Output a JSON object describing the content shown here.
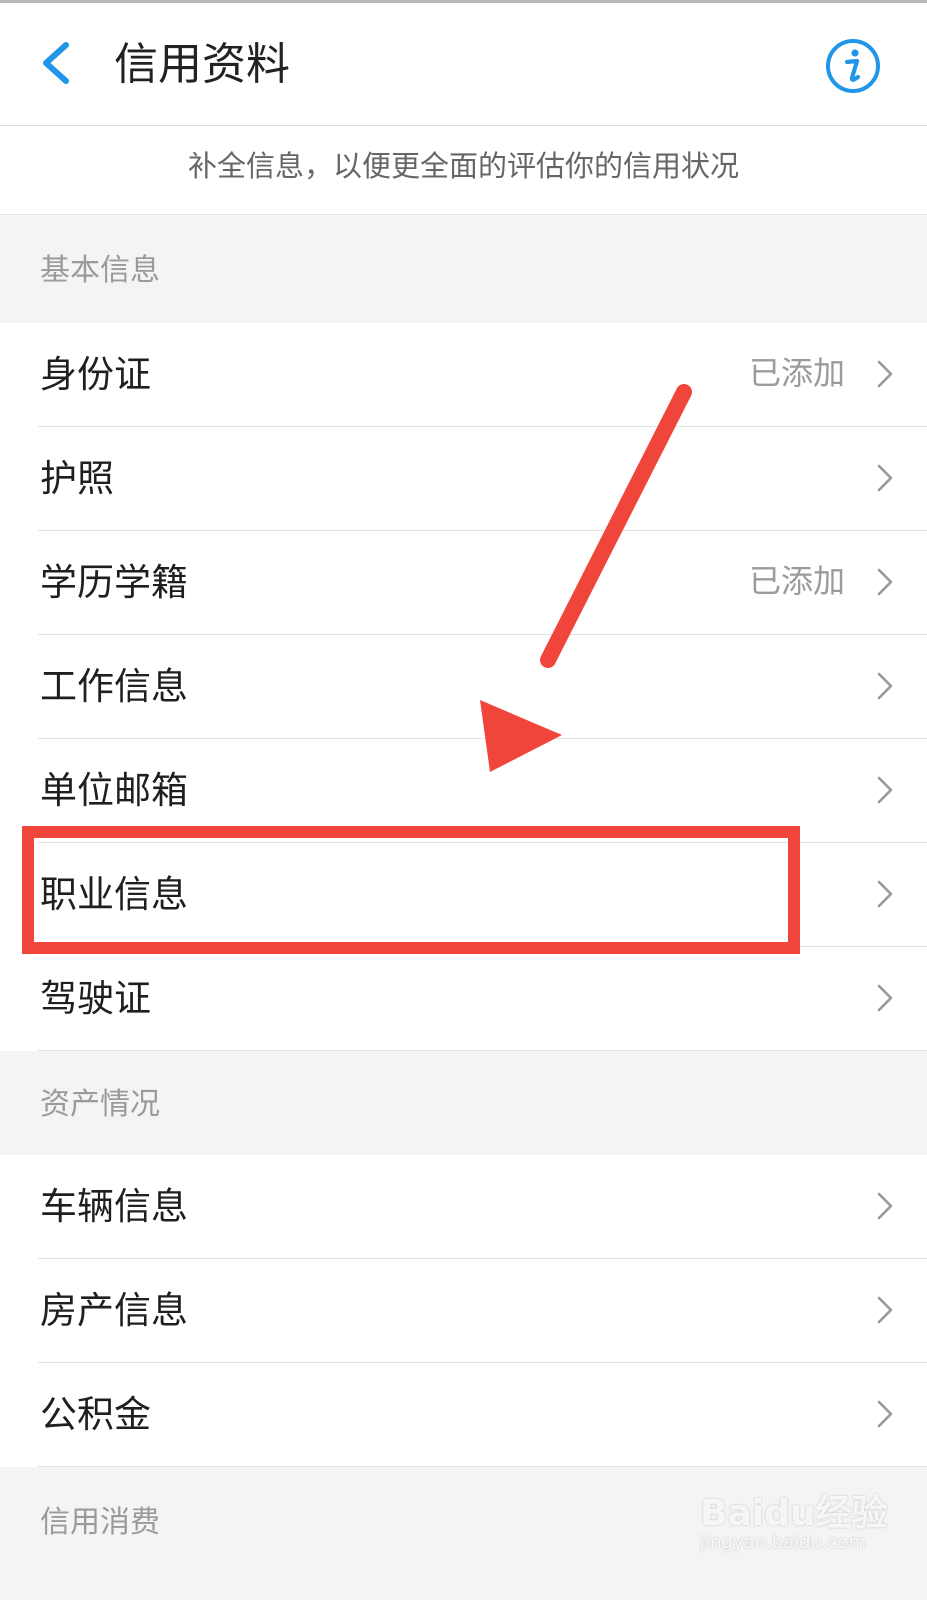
{
  "header": {
    "title": "信用资料",
    "back_icon": "chevron-left-icon",
    "info_icon": "info-circle-icon",
    "accent_color": "#2196e8"
  },
  "subtitle": "补全信息，以便更全面的评估你的信用状况",
  "sections": [
    {
      "title": "基本信息",
      "items": [
        {
          "label": "身份证",
          "status": "已添加"
        },
        {
          "label": "护照",
          "status": ""
        },
        {
          "label": "学历学籍",
          "status": "已添加"
        },
        {
          "label": "工作信息",
          "status": ""
        },
        {
          "label": "单位邮箱",
          "status": ""
        },
        {
          "label": "职业信息",
          "status": ""
        },
        {
          "label": "驾驶证",
          "status": ""
        }
      ]
    },
    {
      "title": "资产情况",
      "items": [
        {
          "label": "车辆信息",
          "status": ""
        },
        {
          "label": "房产信息",
          "status": ""
        },
        {
          "label": "公积金",
          "status": ""
        }
      ]
    },
    {
      "title": "信用消费",
      "items": []
    }
  ],
  "annotation": {
    "highlight_color": "#f0453a",
    "highlighted_item": "职业信息"
  },
  "watermark": {
    "logo": "Baidu经验",
    "url": "jingyan.baidu.com"
  }
}
